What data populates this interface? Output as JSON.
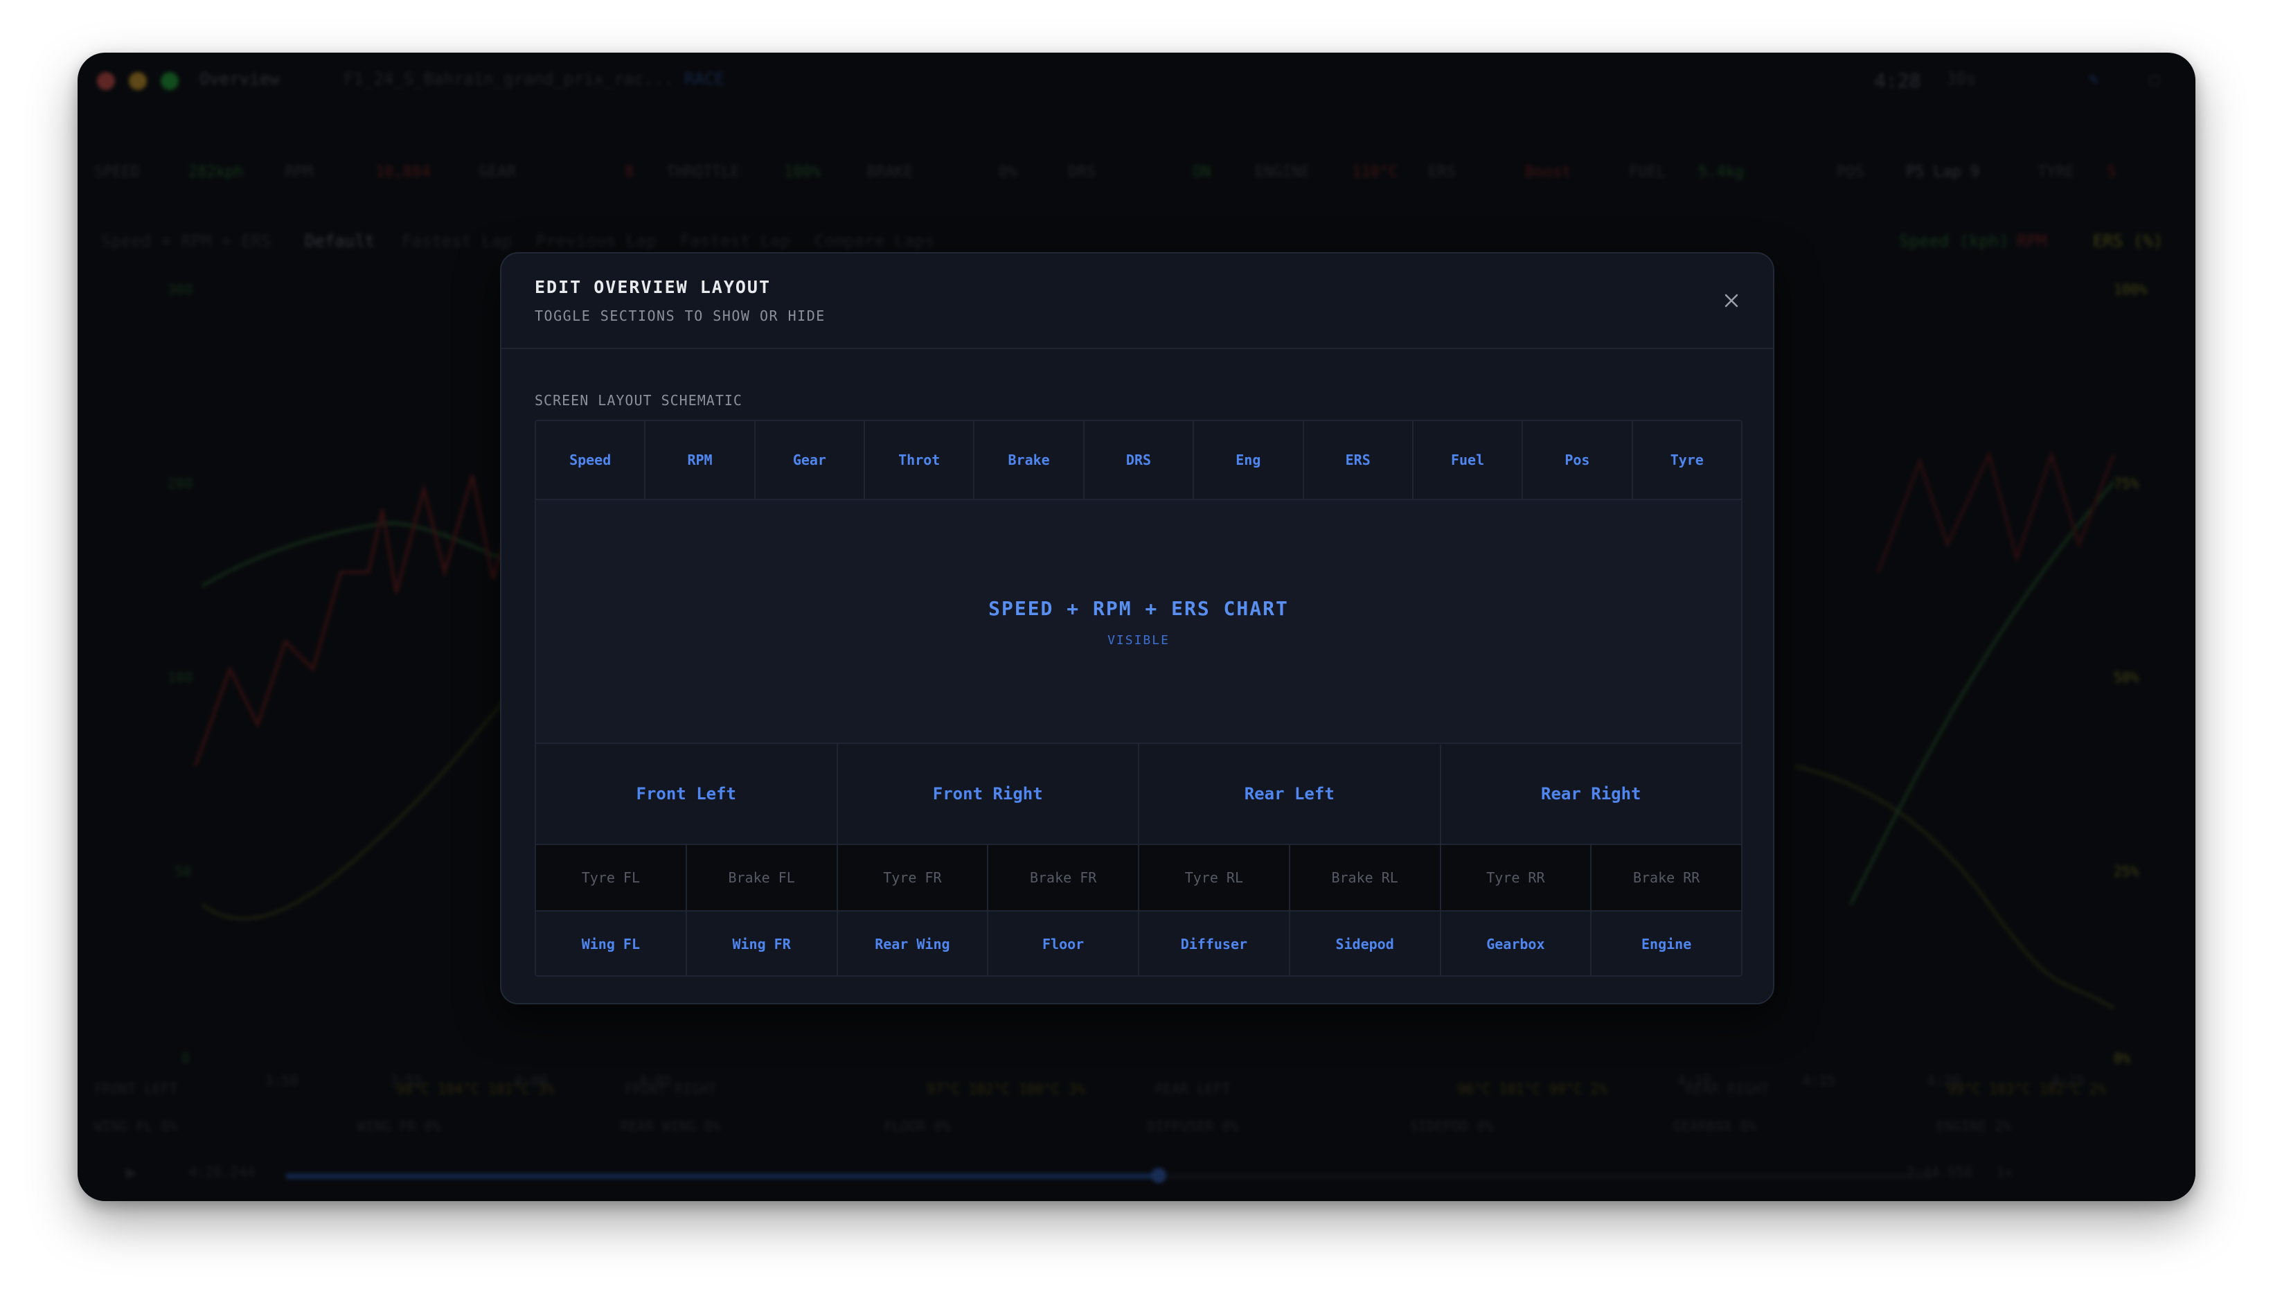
{
  "window": {
    "tab_title": "Overview",
    "session_file": "F1_24_S_Bahrain_grand_prix_rac...",
    "session_badge": "RACE",
    "clock": "4:28",
    "zoom": "30s",
    "colors": {
      "close": "#ff5f57",
      "minimize": "#febc2e",
      "maximize": "#28c840",
      "accent": "#4f86f0"
    }
  },
  "background": {
    "telemetry": [
      {
        "label": "SPEED",
        "value": "282kph"
      },
      {
        "label": "RPM",
        "value": "10,884"
      },
      {
        "label": "GEAR",
        "value": "8"
      },
      {
        "label": "THROTTLE",
        "value": "100%"
      },
      {
        "label": "BRAKE",
        "value": "0%"
      },
      {
        "label": "DRS",
        "value": "ON"
      },
      {
        "label": "ENGINE",
        "value": "110°C"
      },
      {
        "label": "ERS",
        "value": "Boost"
      },
      {
        "label": "FUEL",
        "value": "5.4kg"
      },
      {
        "label": "POS",
        "value": "P5 Lap 9"
      },
      {
        "label": "TYRE",
        "value": "S"
      }
    ],
    "tabs": [
      "Speed + RPM + ERS",
      "Default",
      "Fastest Lap",
      "Previous Lap",
      "Fastest Lap",
      "Compare Laps"
    ],
    "active_tab_index": 1,
    "legend": [
      "Speed (kph)",
      "RPM",
      "ERS (%)"
    ],
    "y_ticks": [
      "300",
      "200",
      "100",
      "50",
      "0"
    ],
    "y_ticks_right": [
      "100%",
      "75%",
      "50%",
      "25%",
      "0%"
    ],
    "x_ticks": [
      "3:50",
      "3:55",
      "4:00",
      "4:05",
      "4:10",
      "4:15",
      "4:20",
      "4:25"
    ],
    "wheel_panels": [
      {
        "name": "FRONT LEFT",
        "stats": "98°C 104°C 101°C 3%"
      },
      {
        "name": "FRONT RIGHT",
        "stats": "97°C 102°C 100°C 3%"
      },
      {
        "name": "REAR LEFT",
        "stats": "96°C 101°C 99°C 2%"
      },
      {
        "name": "REAR RIGHT",
        "stats": "99°C 103°C 102°C 2%"
      }
    ],
    "damage_items": [
      "WING FL 0%",
      "WING FR 0%",
      "REAR WING 0%",
      "FLOOR 0%",
      "DIFFUSER 0%",
      "SIDEPOD 0%",
      "GEARBOX 0%",
      "ENGINE 2%"
    ],
    "playback_start": "4:28.244",
    "playback_end": "7:44.958",
    "playback_speed": "1x",
    "playback_progress": 0.53
  },
  "modal": {
    "title": "EDIT OVERVIEW LAYOUT",
    "subtitle": "TOGGLE SECTIONS TO SHOW OR HIDE",
    "section_label": "SCREEN LAYOUT SCHEMATIC",
    "top_row": [
      "Speed",
      "RPM",
      "Gear",
      "Throt",
      "Brake",
      "DRS",
      "Eng",
      "ERS",
      "Fuel",
      "Pos",
      "Tyre"
    ],
    "chart": {
      "title": "SPEED + RPM + ERS CHART",
      "status": "VISIBLE"
    },
    "wheels": [
      "Front Left",
      "Front Right",
      "Rear Left",
      "Rear Right"
    ],
    "hidden_row": [
      "Tyre FL",
      "Brake FL",
      "Tyre FR",
      "Brake FR",
      "Tyre RL",
      "Brake RL",
      "Tyre RR",
      "Brake RR"
    ],
    "aero_row": [
      "Wing FL",
      "Wing FR",
      "Rear Wing",
      "Floor",
      "Diffuser",
      "Sidepod",
      "Gearbox",
      "Engine"
    ]
  }
}
